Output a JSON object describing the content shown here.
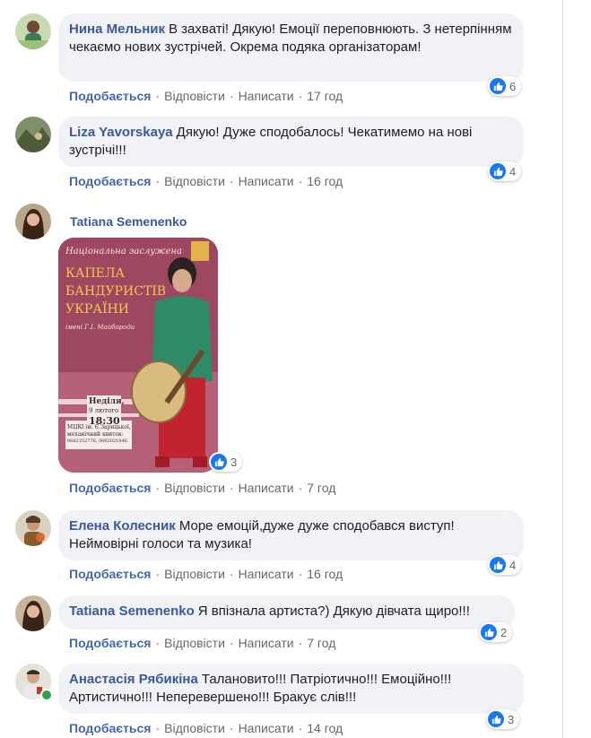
{
  "actions": {
    "like": "Подобається",
    "reply": "Відповісти",
    "write": "Написати"
  },
  "comments": [
    {
      "author": "Нина Мельник",
      "text": "В захваті! Дякую! Емоції переповнюють. З нетерпінням чекаємо нових зустрічей. Окрема подяка організаторам!",
      "time": "17 год",
      "reactions": "6"
    },
    {
      "author": "Liza Yavorskaya",
      "text": "Дякую! Дуже сподобалось! Чекатимемо на нові зустрічі!!!",
      "time": "16 год",
      "reactions": "4"
    },
    {
      "author": "Tatiana Semenenko",
      "text": "",
      "time": "7 год",
      "reactions": "3",
      "image": {
        "line1": "Національна заслужена",
        "line2": "КАПЕЛА",
        "line3": "БАНДУРИСТІВ",
        "line4": "УКРАЇНИ",
        "line5": "імені Г.І. Майбороди",
        "day": "Неділя,",
        "date": "9 лютого",
        "hour": "18:30",
        "venue": "МЦКІ ім. Є.Зарицької,",
        "venue2": "механічний квиток:",
        "phones": "0682152776, 0662021846."
      }
    },
    {
      "author": "Елена Колесник",
      "text": "Море емоцій,дуже дуже сподобався виступ! Неймовірні голоси та музика!",
      "time": "16 год",
      "reactions": "4"
    },
    {
      "author": "Tatiana Semenenko",
      "text": "Я впізнала артиста?) Дякую дівчата щиро!!!",
      "time": "7 год",
      "reactions": "2"
    },
    {
      "author": "Анастасія Рябикіна",
      "text": "Талановито!!! Патріотично!!! Емоційно!!! Артистично!!! Неперевершено!!! Бракує слів!!!",
      "time": "14 год",
      "reactions": "3"
    }
  ],
  "colors": {
    "link": "#385898",
    "like_blue": "#1877f2",
    "bubble": "#f0f2f5",
    "meta": "#65676b",
    "online": "#31a24c"
  },
  "icons": {
    "reaction": "thumbs-up-icon"
  }
}
